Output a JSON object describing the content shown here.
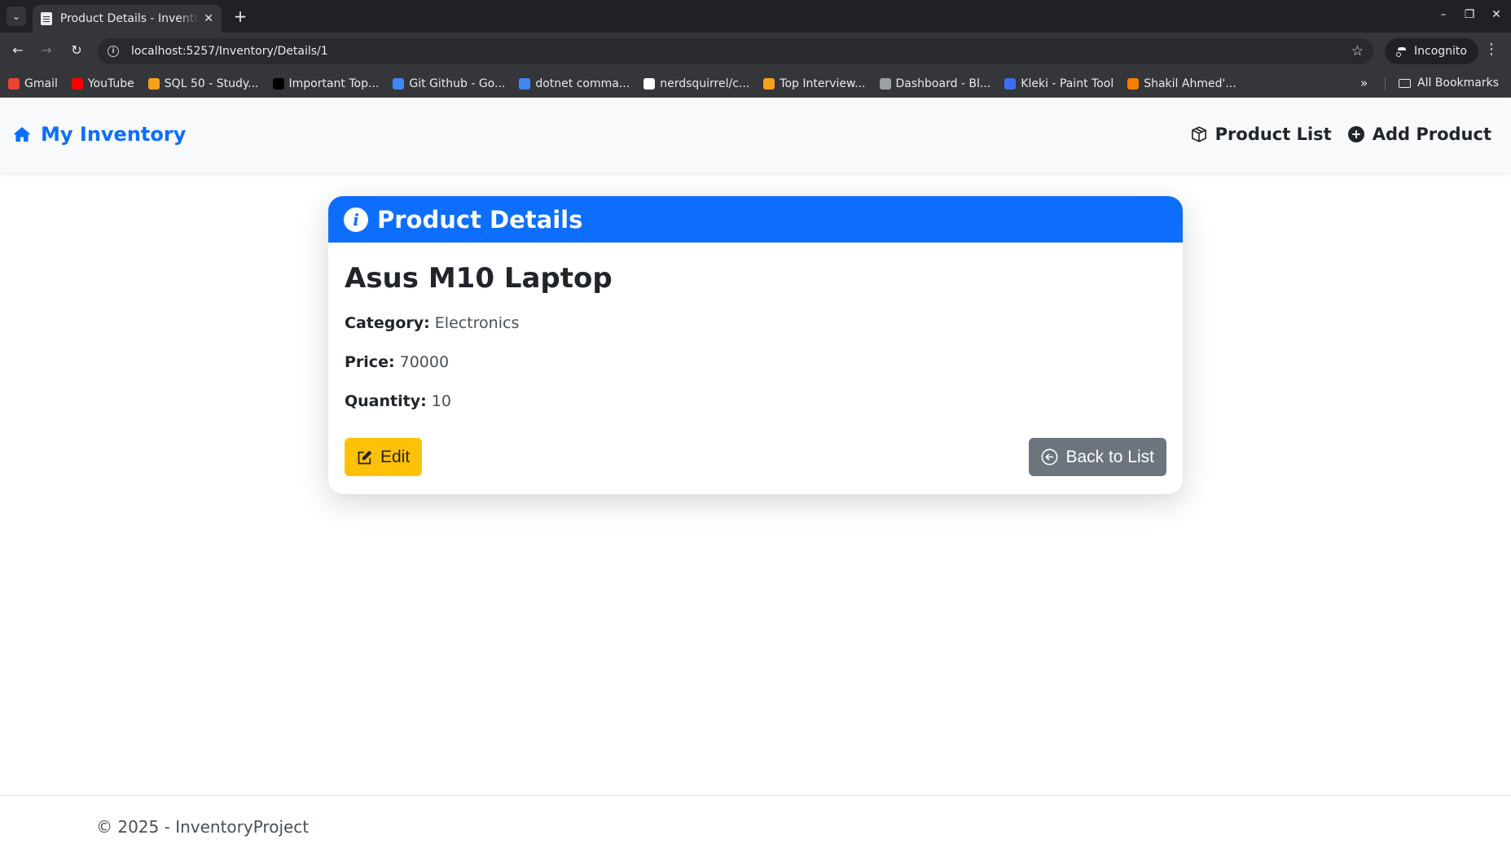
{
  "browser": {
    "tab_title": "Product Details - InventoryProject",
    "url": "localhost:5257/Inventory/Details/1",
    "profile_label": "Incognito",
    "bookmarks": [
      {
        "label": "Gmail",
        "icon": "gmail-icon",
        "color": "#ea4335"
      },
      {
        "label": "YouTube",
        "icon": "youtube-icon",
        "color": "#ff0000"
      },
      {
        "label": "SQL 50 - Study...",
        "icon": "leetcode-icon",
        "color": "#f89f1b"
      },
      {
        "label": "Important Top...",
        "icon": "medium-icon",
        "color": "#000000"
      },
      {
        "label": "Git Github - Go...",
        "icon": "docs-icon",
        "color": "#4285f4"
      },
      {
        "label": "dotnet comma...",
        "icon": "docs-icon",
        "color": "#4285f4"
      },
      {
        "label": "nerdsquirrel/c...",
        "icon": "github-icon",
        "color": "#ffffff"
      },
      {
        "label": "Top Interview...",
        "icon": "leetcode-icon",
        "color": "#f89f1b"
      },
      {
        "label": "Dashboard - Bl...",
        "icon": "globe-icon",
        "color": "#9aa0a6"
      },
      {
        "label": "Kleki - Paint Tool",
        "icon": "kleki-icon",
        "color": "#3b6ef5"
      },
      {
        "label": "Shakil Ahmed'...",
        "icon": "blogger-icon",
        "color": "#f57d00"
      }
    ],
    "all_bookmarks_label": "All Bookmarks"
  },
  "navbar": {
    "brand": "My Inventory",
    "links": {
      "product_list": "Product List",
      "add_product": "Add Product"
    }
  },
  "card": {
    "header": "Product Details",
    "product_name": "Asus M10 Laptop",
    "fields": {
      "category_label": "Category:",
      "category_value": "Electronics",
      "price_label": "Price:",
      "price_value": "70000",
      "quantity_label": "Quantity:",
      "quantity_value": "10"
    },
    "edit_label": "Edit",
    "back_label": "Back to List"
  },
  "footer": {
    "text": "© 2025 - InventoryProject"
  },
  "colors": {
    "primary": "#0d6efd",
    "warning": "#ffc107",
    "secondary": "#6c757d"
  }
}
